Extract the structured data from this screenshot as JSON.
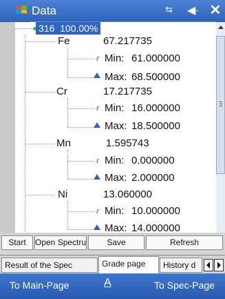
{
  "title_bar": {
    "app_title": "Data",
    "icons": [
      "windows-start-icon",
      "network-icon",
      "volume-icon",
      "close-icon"
    ]
  },
  "tree": {
    "root_label": "316  100.00%",
    "elements": [
      {
        "symbol": "Fe",
        "value": "67.217735",
        "min_label": "Min:",
        "min_value": "61.000000",
        "max_label": "Max:",
        "max_value": "68.500000"
      },
      {
        "symbol": "Cr",
        "value": "17.217735",
        "min_label": "Min:",
        "min_value": "16.000000",
        "max_label": "Max:",
        "max_value": "18.500000"
      },
      {
        "symbol": "Mn",
        "value": "1.595743",
        "min_label": "Min:",
        "min_value": "0.000000",
        "max_label": "Max:",
        "max_value": "2.000000"
      },
      {
        "symbol": "Ni",
        "value": "13.060000",
        "min_label": "Min:",
        "min_value": "10.000000",
        "max_label": "Max:",
        "max_value": "14.000000"
      }
    ]
  },
  "toolbar": {
    "start": "Start",
    "open_spectrum": "Open Spectrum",
    "save": "Save",
    "refresh": "Refresh"
  },
  "tabs": {
    "result": "Result of the Spec",
    "grade": "Grade page",
    "history": "History d"
  },
  "softkeys": {
    "left": "To Main-Page",
    "middle": "A",
    "right": "To Spec-Page"
  },
  "colors": {
    "titlebar": "#2d62b8",
    "selection": "#2f63c4",
    "min_icon": "#39b539",
    "max_icon": "#2f5fb8"
  }
}
